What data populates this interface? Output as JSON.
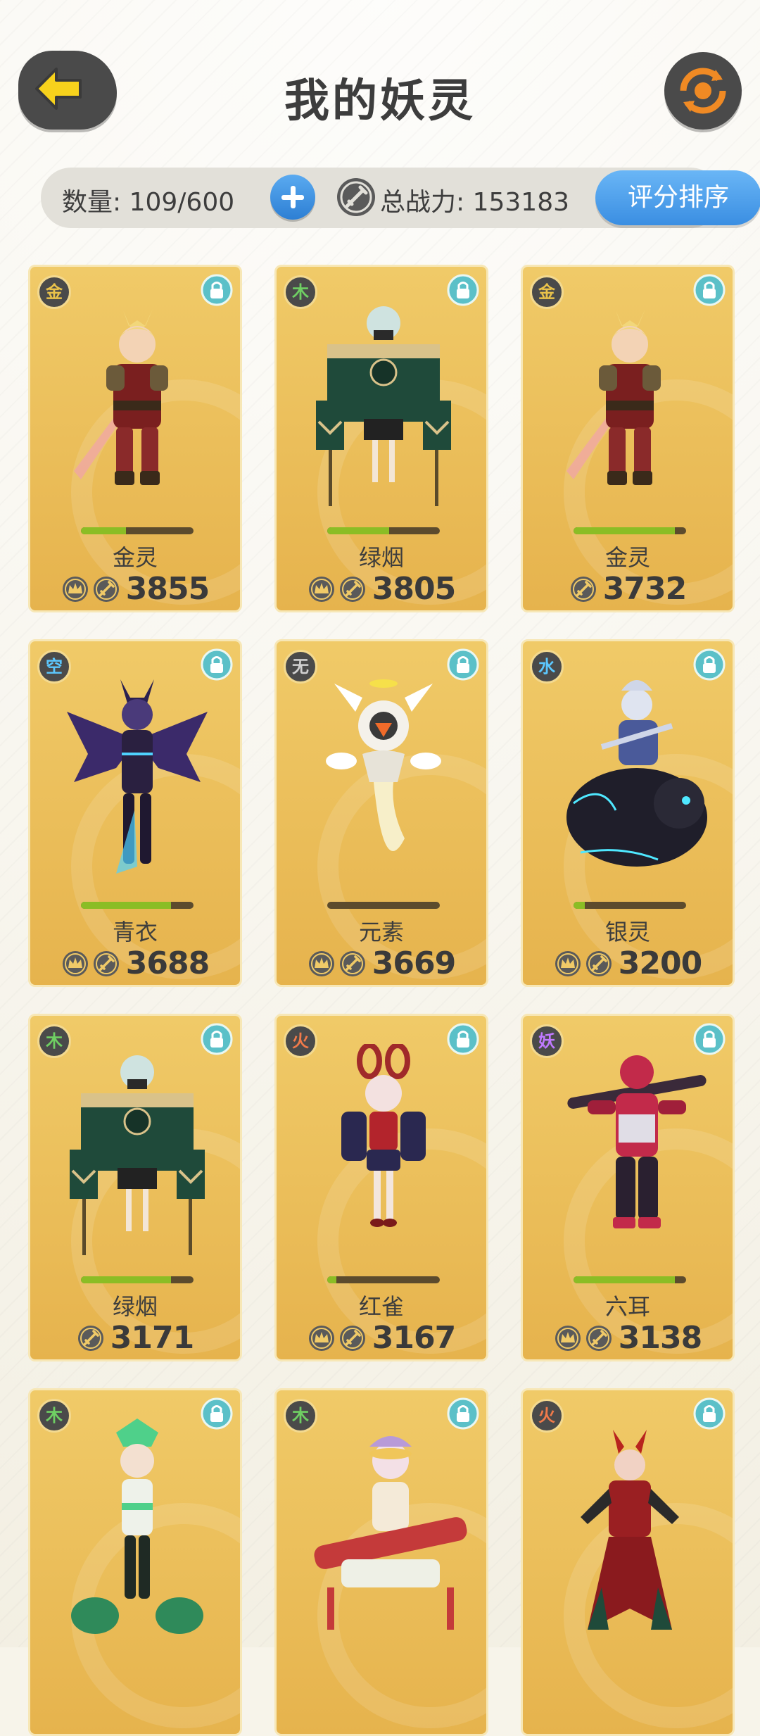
{
  "header": {
    "title": "我的妖灵"
  },
  "stats": {
    "count_label": "数量: 109/600",
    "power_label": "总战力: 153183",
    "sort_label": "评分排序"
  },
  "colors": {
    "element_jin": "#e9c24a",
    "element_mu": "#6fcf63",
    "element_kong": "#5cc8ff",
    "element_wu": "#d0d0d0",
    "element_shui": "#5cc8ff",
    "element_huo": "#f07a4a",
    "element_yao": "#c07aff",
    "level_fill": "#8bbd25",
    "card_gold": "#e6b34d"
  },
  "cards": [
    {
      "element": "金",
      "element_color": "#e9c24a",
      "name": "金灵",
      "power": "3855",
      "crown": true,
      "level": 0.4,
      "figure": "warrior-red"
    },
    {
      "element": "木",
      "element_color": "#6fcf63",
      "name": "绿烟",
      "power": "3805",
      "crown": true,
      "level": 0.55,
      "figure": "puppet-green"
    },
    {
      "element": "金",
      "element_color": "#e9c24a",
      "name": "金灵",
      "power": "3732",
      "crown": false,
      "level": 0.9,
      "figure": "warrior-red"
    },
    {
      "element": "空",
      "element_color": "#5cc8ff",
      "name": "青衣",
      "power": "3688",
      "crown": true,
      "level": 0.8,
      "figure": "bat-purple"
    },
    {
      "element": "无",
      "element_color": "#d0d0d0",
      "name": "元素",
      "power": "3669",
      "crown": true,
      "level": 0.0,
      "figure": "spirit-white"
    },
    {
      "element": "水",
      "element_color": "#5cc8ff",
      "name": "银灵",
      "power": "3200",
      "crown": true,
      "level": 0.1,
      "figure": "rider-beast"
    },
    {
      "element": "木",
      "element_color": "#6fcf63",
      "name": "绿烟",
      "power": "3171",
      "crown": false,
      "level": 0.8,
      "figure": "puppet-green"
    },
    {
      "element": "火",
      "element_color": "#f07a4a",
      "name": "红雀",
      "power": "3167",
      "crown": true,
      "level": 0.08,
      "figure": "girl-red"
    },
    {
      "element": "妖",
      "element_color": "#c07aff",
      "name": "六耳",
      "power": "3138",
      "crown": true,
      "level": 0.9,
      "figure": "monkey-club"
    },
    {
      "element": "木",
      "element_color": "#6fcf63",
      "name": "",
      "power": "",
      "crown": false,
      "level": null,
      "figure": "boy-green"
    },
    {
      "element": "木",
      "element_color": "#6fcf63",
      "name": "",
      "power": "",
      "crown": false,
      "level": null,
      "figure": "lady-instrument"
    },
    {
      "element": "火",
      "element_color": "#f07a4a",
      "name": "",
      "power": "",
      "crown": false,
      "level": null,
      "figure": "demon-red"
    }
  ]
}
